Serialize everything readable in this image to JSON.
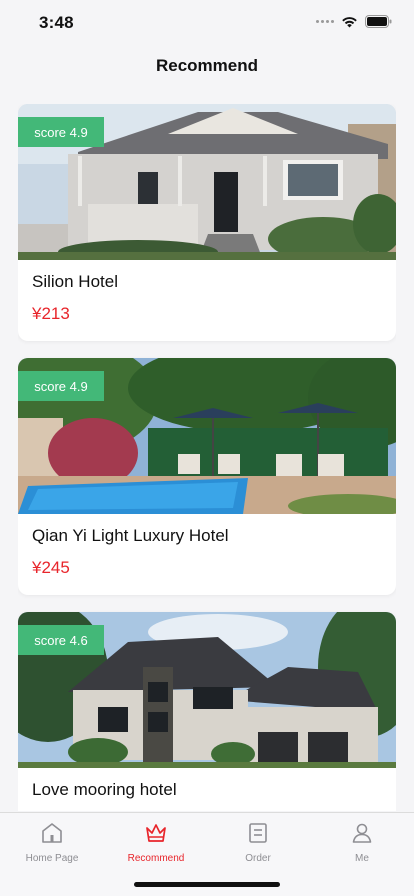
{
  "status_bar": {
    "time": "3:48"
  },
  "nav": {
    "title": "Recommend"
  },
  "hotels": [
    {
      "name": "Silion Hotel",
      "price": "¥213",
      "score": "score 4.9"
    },
    {
      "name": "Qian Yi Light Luxury Hotel",
      "price": "¥245",
      "score": "score 4.9"
    },
    {
      "name": "Love mooring hotel",
      "price": "",
      "score": "score 4.6"
    }
  ],
  "tab_bar": {
    "items": [
      {
        "label": "Home Page",
        "icon": "home-icon",
        "active": false
      },
      {
        "label": "Recommend",
        "icon": "crown-icon",
        "active": true
      },
      {
        "label": "Order",
        "icon": "order-icon",
        "active": false
      },
      {
        "label": "Me",
        "icon": "user-icon",
        "active": false
      }
    ]
  },
  "colors": {
    "accent": "#e8252b",
    "score_badge": "#43b878",
    "tab_inactive": "#8e8e93"
  }
}
